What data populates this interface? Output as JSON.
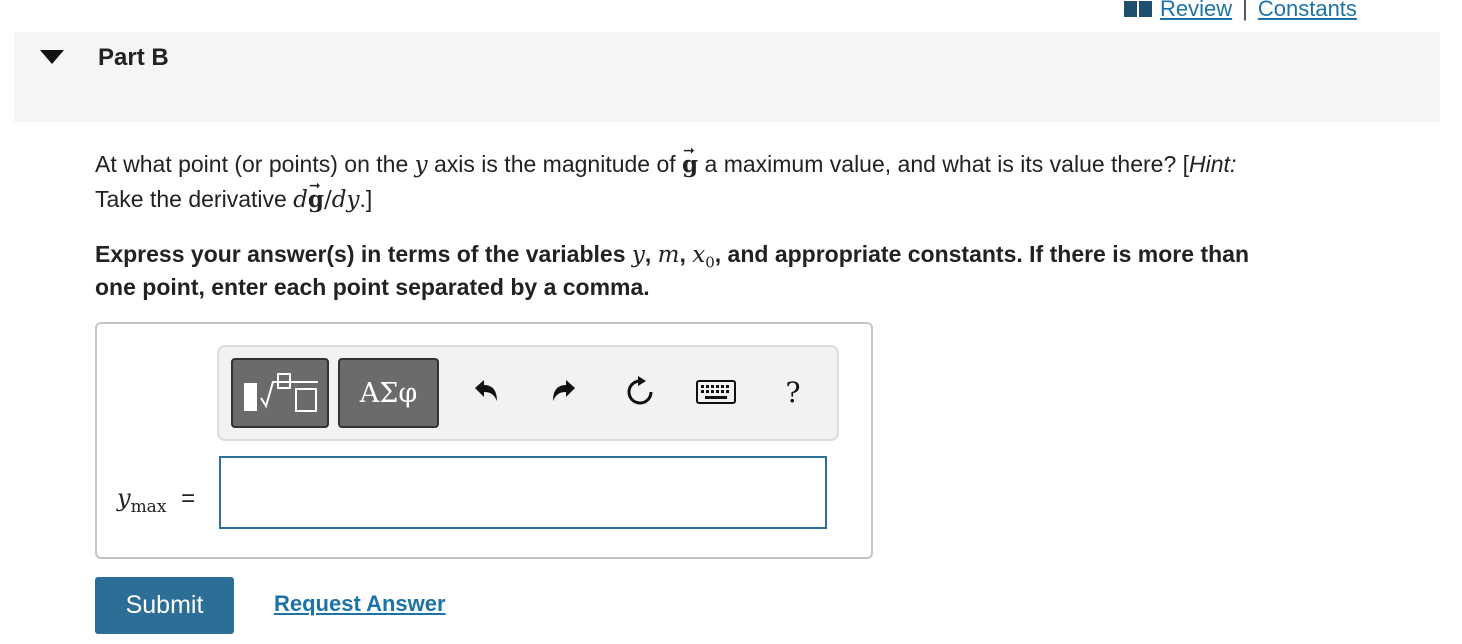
{
  "links": {
    "review": "Review",
    "separator": "|",
    "constants": "Constants"
  },
  "part": {
    "title": "Part B"
  },
  "question": {
    "line1_pre": "At what point (or points) on the ",
    "var_y": "y",
    "line1_mid": " axis is the magnitude of ",
    "g_symbol": "g",
    "vec_arrow": "⃗",
    "line1_post": " a maximum value, and what is its value there? [",
    "hint_label": "Hint:",
    "line2_pre": "Take the derivative ",
    "deriv_d": "d",
    "deriv_slash": "/",
    "deriv_dy": "dy",
    "line2_post": ".]"
  },
  "instructions": {
    "pre": "Express your answer(s) in terms of the variables ",
    "var_y": "y",
    "comma1": ", ",
    "var_m": "m",
    "comma2": ", ",
    "var_x0_base": "x",
    "var_x0_sub": "0",
    "post1": ", and appropriate constants. If there is more than",
    "post2": "one point, enter each point separated by a comma."
  },
  "toolbar": {
    "greek_label": "ΑΣφ",
    "help_label": "?"
  },
  "answer": {
    "var_base": "y",
    "var_sub": "max",
    "equals": "=",
    "value": ""
  },
  "actions": {
    "submit": "Submit",
    "request_answer": "Request Answer"
  },
  "colors": {
    "link": "#1d72a8",
    "submit_bg": "#2c6e96",
    "header_bg": "#f5f5f5",
    "tool_button_bg": "#6b6b6b"
  }
}
